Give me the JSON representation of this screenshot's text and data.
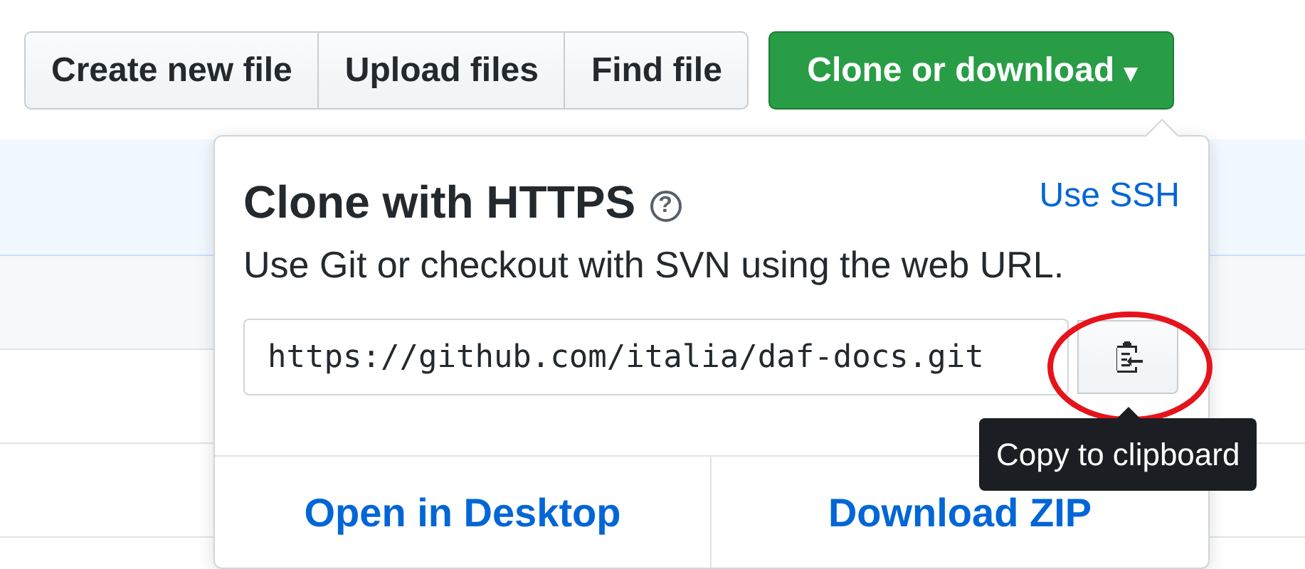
{
  "toolbar": {
    "buttons": [
      "Create new file",
      "Upload files",
      "Find file"
    ],
    "clone_button": {
      "label": "Clone or download",
      "caret": "▾"
    }
  },
  "clone_popup": {
    "title": "Clone with HTTPS",
    "help": "?",
    "switch_link": "Use SSH",
    "description": "Use Git or checkout with SVN using the web URL.",
    "url": {
      "value": "https://github.com/italia/daf-docs.git"
    },
    "copy_tooltip": "Copy to clipboard",
    "highlight_circle": true,
    "actions": [
      "Open in Desktop",
      "Download ZIP"
    ]
  }
}
